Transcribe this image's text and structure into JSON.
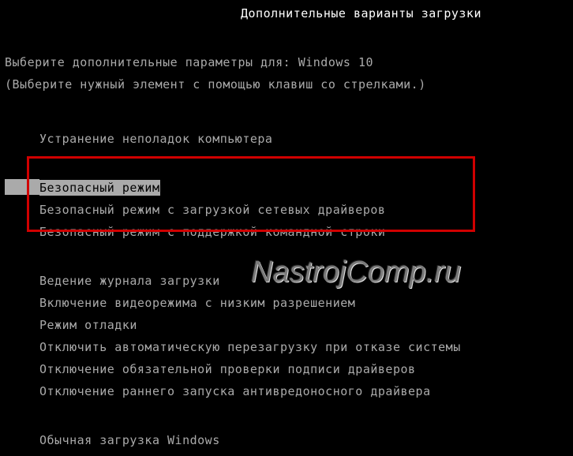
{
  "title": "Дополнительные варианты загрузки",
  "prompt_prefix": "Выберите дополнительные параметры для: ",
  "os_name": "Windows 10",
  "hint": "(Выберите нужный элемент с помощью клавиш со стрелками.)",
  "selected_index": 1,
  "options": [
    "Устранение неполадок компьютера",
    "Безопасный режим",
    "Безопасный режим с загрузкой сетевых драйверов",
    "Безопасный режим с поддержкой командной строки",
    "Ведение журнала загрузки",
    "Включение видеорежима с низким разрешением",
    "Режим отладки",
    "Отключить автоматическую перезагрузку при отказе системы",
    "Отключение обязательной проверки подписи драйверов",
    "Отключение раннего запуска антивредоносного драйвера",
    "Обычная загрузка Windows"
  ],
  "highlight_box": {
    "start": 1,
    "end": 3
  },
  "watermark": "NastrojComp.ru"
}
